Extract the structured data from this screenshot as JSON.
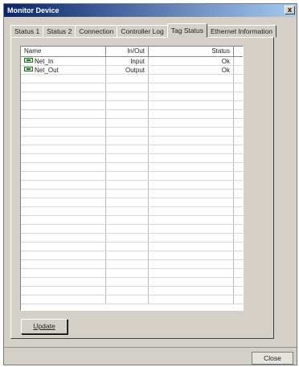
{
  "window": {
    "title": "Monitor Device",
    "close_glyph": "x"
  },
  "tabs": [
    {
      "label": "Status 1"
    },
    {
      "label": "Status 2"
    },
    {
      "label": "Connection"
    },
    {
      "label": "Controller Log"
    },
    {
      "label": "Tag Status",
      "active": true
    },
    {
      "label": "Ethernet Information"
    }
  ],
  "table": {
    "columns": {
      "name": "Name",
      "io": "In/Out",
      "status": "Status"
    },
    "rows": [
      {
        "name": "Net_In",
        "io": "Input",
        "status": "Ok",
        "icon": "tag-icon"
      },
      {
        "name": "Net_Out",
        "io": "Output",
        "status": "Ok",
        "icon": "tag-icon"
      }
    ]
  },
  "buttons": {
    "update_label": "Update",
    "close_label": "Close"
  }
}
